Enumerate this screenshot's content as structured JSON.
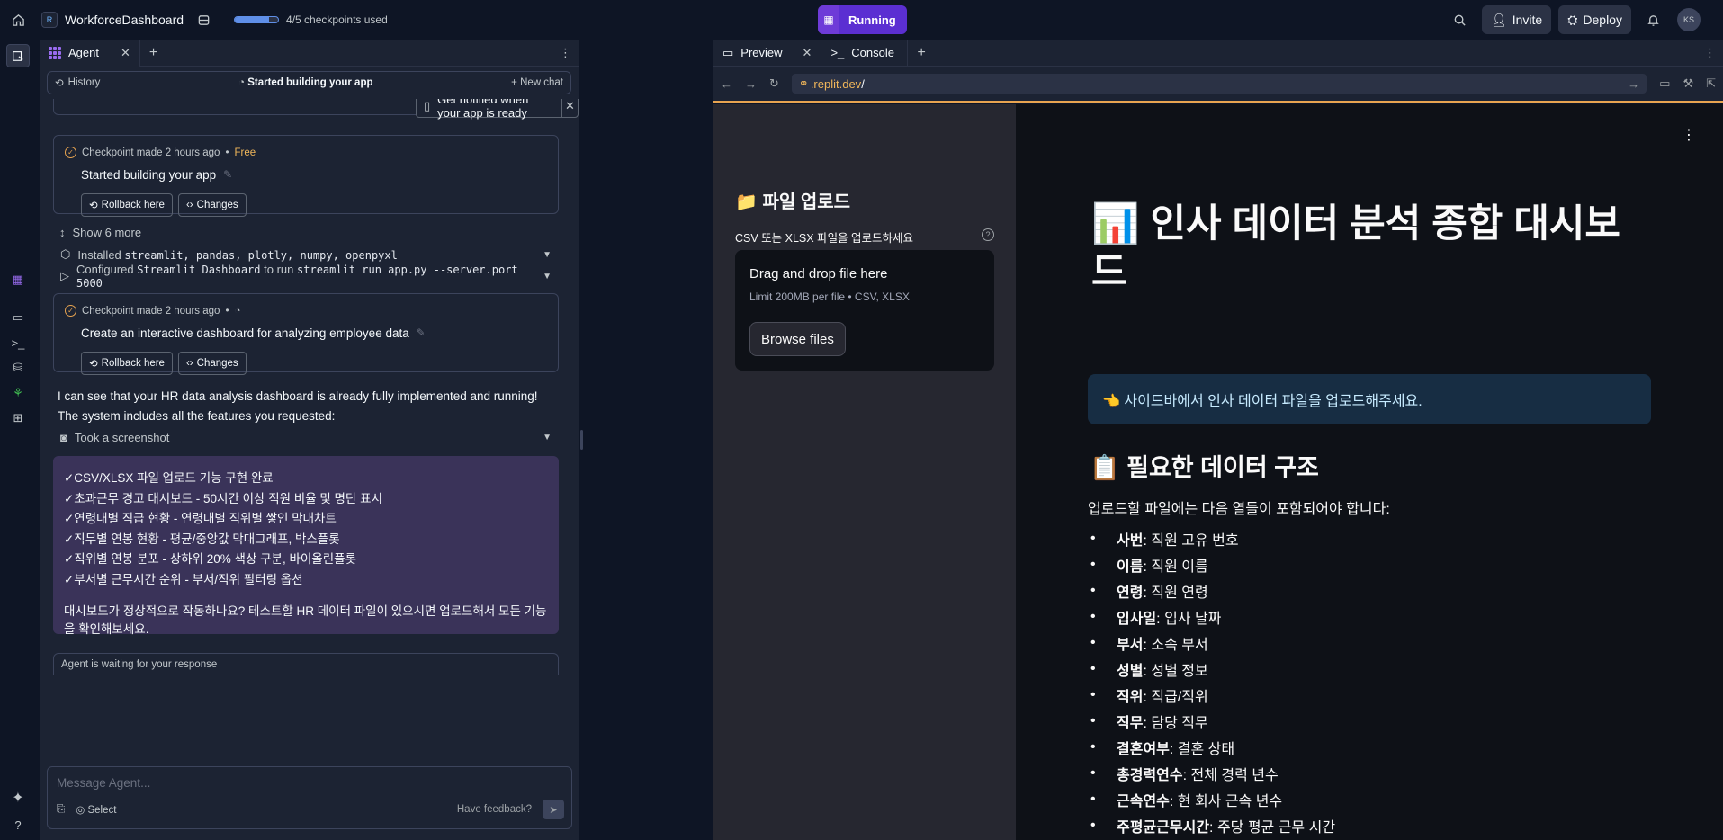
{
  "topbar": {
    "project_name": "WorkforceDashboard",
    "checkpoints": "4/5 checkpoints used",
    "checkpoints_progress": 0.8,
    "status": "Running",
    "invite": "Invite",
    "deploy": "Deploy",
    "avatar": "KS"
  },
  "agent": {
    "tab": "Agent",
    "history": "History",
    "header_title": "Started building your app",
    "new_chat": "New chat",
    "notify": "Get notified when your app is ready",
    "checkpoint1": {
      "meta": "Checkpoint made 2 hours ago",
      "badge": "Free",
      "title": "Started building your app",
      "rollback": "Rollback here",
      "changes": "Changes"
    },
    "show_more": "Show 6 more",
    "installed_prefix": "Installed",
    "installed_pkgs": "streamlit, pandas, plotly, numpy, openpyxl",
    "configured_prefix": "Configured",
    "configured_name": "Streamlit Dashboard",
    "configured_mid": "to run",
    "configured_cmd": "streamlit run app.py --server.port 5000",
    "checkpoint2": {
      "meta": "Checkpoint made 2 hours ago",
      "title": "Create an interactive dashboard for analyzing employee data",
      "rollback": "Rollback here",
      "changes": "Changes"
    },
    "message": "I can see that your HR data analysis dashboard is already fully implemented and running! The system includes all the features you requested:",
    "screenshot": "Took a screenshot",
    "features": [
      "✓CSV/XLSX 파일 업로드 기능 구현 완료",
      "✓초과근무 경고 대시보드 - 50시간 이상 직원 비율 및 명단 표시",
      "✓연령대별 직급 현황 - 연령대별 직위별 쌓인 막대차트",
      "✓직무별 연봉 현황 - 평균/중앙값 막대그래프, 박스플롯",
      "✓직위별 연봉 분포 - 상하위 20% 색상 구분, 바이올린플롯",
      "✓부서별 근무시간 순위 - 부서/직위 필터링 옵션"
    ],
    "question": "대시보드가 정상적으로 작동하나요? 테스트할 HR 데이터 파일이 있으시면 업로드해서 모든 기능을 확인해보세요.",
    "waiting": "Agent is waiting for your response",
    "placeholder": "Message Agent...",
    "select": "Select",
    "feedback": "Have feedback?"
  },
  "preview": {
    "tab_preview": "Preview",
    "tab_console": "Console",
    "url_domain": ".replit.dev",
    "url_path": "/",
    "sidebar": {
      "title": "📁 파일 업로드",
      "label": "CSV 또는 XLSX 파일을 업로드하세요",
      "drop_title": "Drag and drop file here",
      "drop_sub": "Limit 200MB per file • CSV, XLSX",
      "browse": "Browse files"
    },
    "main": {
      "title": "📊 인사 데이터 분석 종합 대시보드",
      "info": "👈 사이드바에서 인사 데이터 파일을 업로드해주세요.",
      "subtitle": "📋 필요한 데이터 구조",
      "intro": "업로드할 파일에는 다음 열들이 포함되어야 합니다:",
      "columns": [
        {
          "k": "사번",
          "v": ": 직원 고유 번호"
        },
        {
          "k": "이름",
          "v": ": 직원 이름"
        },
        {
          "k": "연령",
          "v": ": 직원 연령"
        },
        {
          "k": "입사일",
          "v": ": 입사 날짜"
        },
        {
          "k": "부서",
          "v": ": 소속 부서"
        },
        {
          "k": "성별",
          "v": ": 성별 정보"
        },
        {
          "k": "직위",
          "v": ": 직급/직위"
        },
        {
          "k": "직무",
          "v": ": 담당 직무"
        },
        {
          "k": "결혼여부",
          "v": ": 결혼 상태"
        },
        {
          "k": "총경력연수",
          "v": ": 전체 경력 년수"
        },
        {
          "k": "근속연수",
          "v": ": 현 회사 근속 년수"
        },
        {
          "k": "주평균근무시간",
          "v": ": 주당 평균 근무 시간"
        }
      ]
    }
  }
}
